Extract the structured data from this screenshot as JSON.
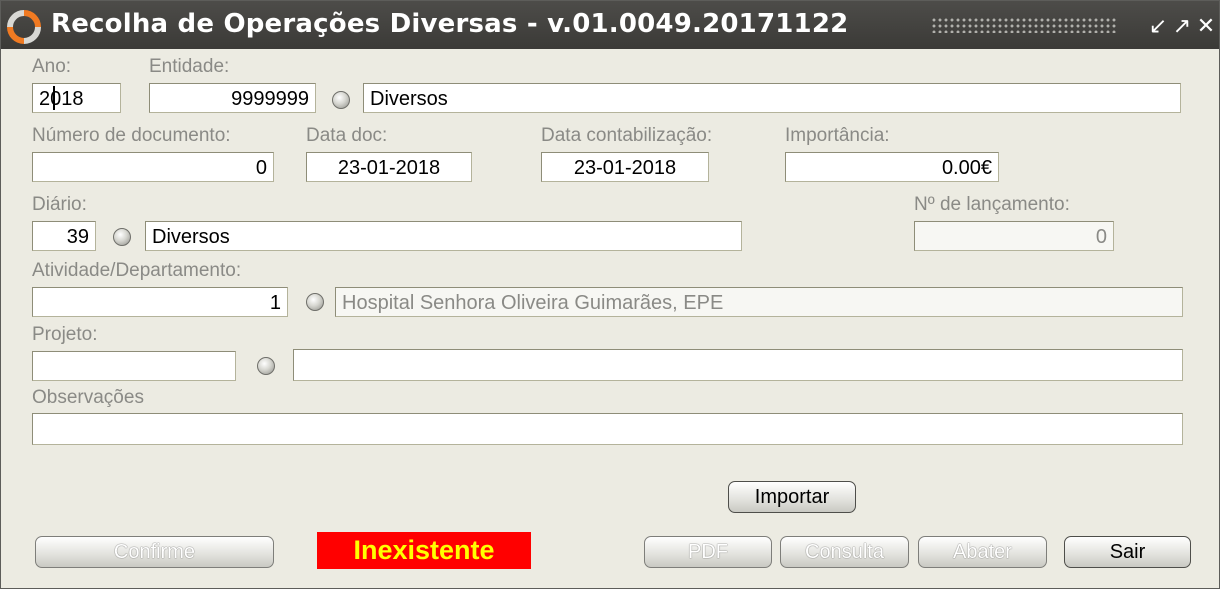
{
  "window": {
    "title": "Recolha de Operações Diversas - v.01.0049.20171122",
    "controls": {
      "minimize": "↙",
      "maximize": "↗",
      "close": "✕"
    }
  },
  "fields": {
    "ano": {
      "label": "Ano:",
      "value": "2018"
    },
    "entidade": {
      "label": "Entidade:",
      "code": "9999999",
      "name": "Diversos"
    },
    "numero_documento": {
      "label": "Número de documento:",
      "value": "0"
    },
    "data_doc": {
      "label": "Data doc:",
      "value": "23-01-2018"
    },
    "data_contabilizacao": {
      "label": "Data contabilização:",
      "value": "23-01-2018"
    },
    "importancia": {
      "label": "Importância:",
      "value": "0.00€"
    },
    "diario": {
      "label": "Diário:",
      "code": "39",
      "name": "Diversos"
    },
    "numero_lancamento": {
      "label": "Nº de lançamento:",
      "value": "0"
    },
    "atividade": {
      "label": "Atividade/Departamento:",
      "code": "1",
      "name": "Hospital Senhora Oliveira Guimarães, EPE"
    },
    "projeto": {
      "label": "Projeto:",
      "code": "",
      "name": ""
    },
    "observacoes": {
      "label": "Observações",
      "value": ""
    }
  },
  "buttons": {
    "importar": "Importar",
    "confirme": "Confirme",
    "pdf": "PDF",
    "consulta": "Consulta",
    "abater": "Abater",
    "sair": "Sair"
  },
  "status": {
    "text": "Inexistente",
    "background": "#ff0000",
    "color": "#ffff00"
  },
  "colors": {
    "titlebar": "#3f3e3b",
    "window_bg": "#ecebe2",
    "label": "#8a8a86",
    "logo_accent": "#f07a22"
  }
}
